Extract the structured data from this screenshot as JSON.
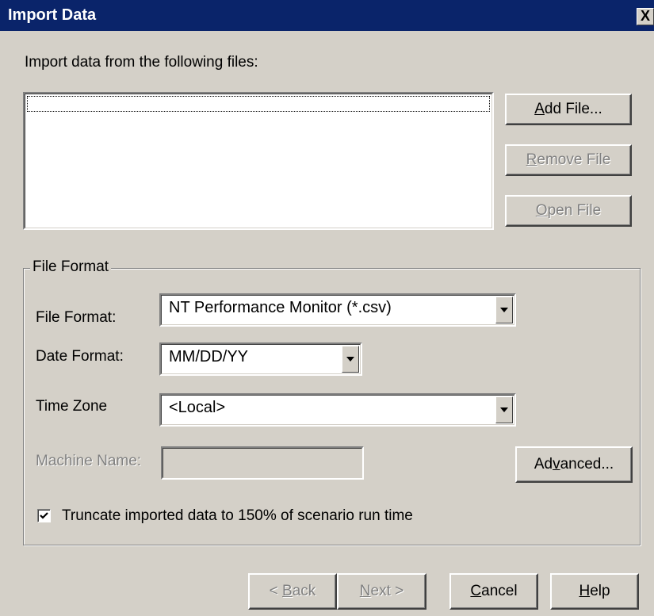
{
  "window": {
    "title": "Import Data",
    "close_symbol": "X"
  },
  "files": {
    "prompt": "Import data from the following files:",
    "items": []
  },
  "buttons": {
    "add_file": {
      "pre": "",
      "key": "A",
      "post": "dd File..."
    },
    "remove_file": {
      "pre": "",
      "key": "R",
      "post": "emove File"
    },
    "open_file": {
      "pre": "",
      "key": "O",
      "post": "pen File"
    },
    "advanced": {
      "pre": "Ad",
      "key": "v",
      "post": "anced..."
    },
    "back": {
      "pre": "< ",
      "key": "B",
      "post": "ack"
    },
    "next": {
      "pre": "",
      "key": "N",
      "post": "ext >"
    },
    "cancel": {
      "pre": "",
      "key": "C",
      "post": "ancel"
    },
    "help": {
      "pre": "",
      "key": "H",
      "post": "elp"
    }
  },
  "file_format_group": {
    "title": "File Format",
    "file_format_label": "File Format:",
    "file_format_value": "NT Performance Monitor (*.csv)",
    "date_format_label": "Date Format:",
    "date_format_value": "MM/DD/YY",
    "time_zone_label": "Time Zone",
    "time_zone_value": "<Local>",
    "machine_name_label": "Machine Name:",
    "machine_name_value": "",
    "truncate_label": "Truncate imported data to 150% of scenario run time",
    "truncate_checked": true
  },
  "colors": {
    "title_bar": "#0a246a",
    "dialog_bg": "#d4d0c8",
    "disabled_text": "#808080"
  }
}
